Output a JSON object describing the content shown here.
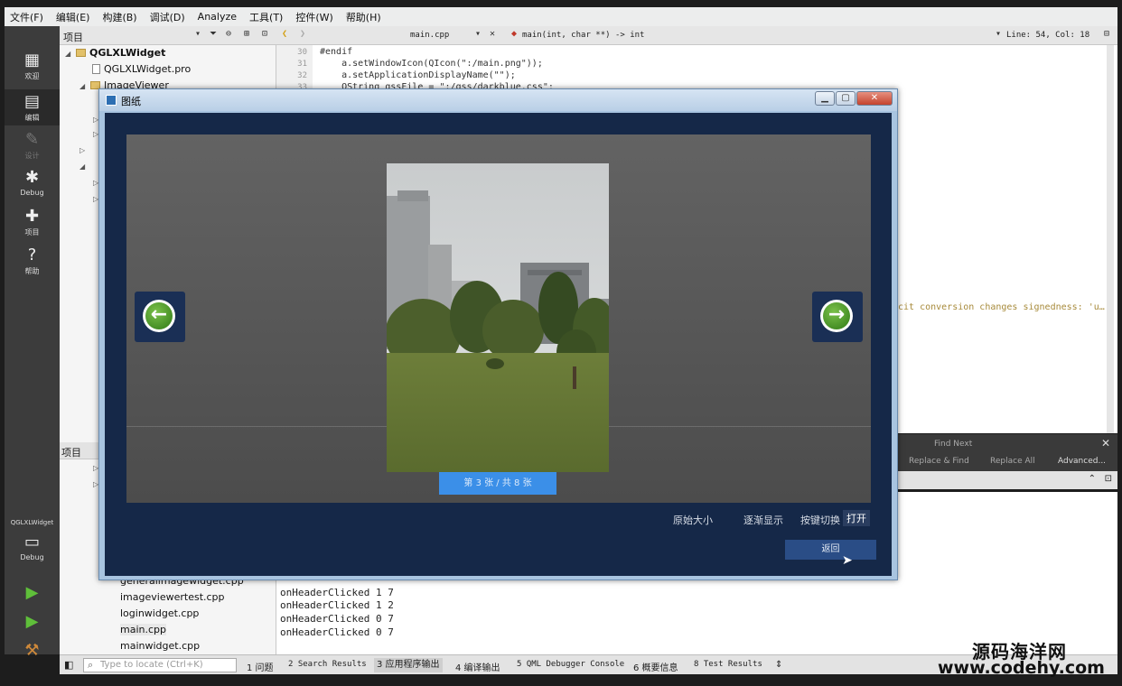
{
  "menu": [
    "文件(F)",
    "编辑(E)",
    "构建(B)",
    "调试(D)",
    "Analyze",
    "工具(T)",
    "控件(W)",
    "帮助(H)"
  ],
  "modes": [
    {
      "icon": "grid-icon",
      "label": "欢迎"
    },
    {
      "icon": "edit-icon",
      "label": "编辑"
    },
    {
      "icon": "design-icon",
      "label": "设计"
    },
    {
      "icon": "bug-icon",
      "label": "Debug"
    },
    {
      "icon": "wrench-icon",
      "label": "项目"
    },
    {
      "icon": "help-icon",
      "label": "帮助"
    }
  ],
  "kit": {
    "project": "QGLXLWidget",
    "mode": "Debug"
  },
  "toolbar": {
    "panel_title": "项目",
    "file_tab": "main.cpp",
    "function_selector": "main(int, char **) -> int",
    "line_col": "Line: 54, Col: 18"
  },
  "tree": {
    "root": "QGLXLWidget",
    "pro_file": "QGLXLWidget.pro",
    "subproject": "ImageViewer"
  },
  "tree2": {
    "header": "项目",
    "files": [
      "generalimagewidget.cpp",
      "imageviewertest.cpp",
      "loginwidget.cpp",
      "main.cpp",
      "mainwidget.cpp"
    ]
  },
  "editor": {
    "line_numbers": [
      "30",
      "31",
      "32",
      "33"
    ],
    "lines": [
      "#endif",
      "    a.setWindowIcon(QIcon(\":/main.png\"));",
      "    a.setApplicationDisplayName(\"\");",
      "    QString qssFile = \":/qss/darkblue.css\";"
    ],
    "warning": "cit conversion changes signedness: 'u…'"
  },
  "search": {
    "find_next": "Find Next",
    "replace_find": "Replace & Find",
    "replace_all": "Replace All",
    "advanced": "Advanced..."
  },
  "output": {
    "lines": [
      "onHeaderClicked 1 7",
      "onHeaderClicked 1 2",
      "onHeaderClicked 0 7",
      "onHeaderClicked 0 7"
    ]
  },
  "status": {
    "locate_placeholder": "Type to locate (Ctrl+K)",
    "panes": [
      "1 问题",
      "2 Search Results",
      "3 应用程序输出",
      "4 编译输出",
      "5 QML Debugger Console",
      "6 概要信息",
      "8 Test Results"
    ]
  },
  "dialog": {
    "title": "图纸",
    "page_indicator": "第 3 张 / 共 8 张",
    "options": {
      "original_size": "原始大小",
      "fade_in": "逐渐显示",
      "key_switch": "按键切换",
      "open": "打开"
    },
    "return_label": "返回"
  },
  "watermark": {
    "line1": "源码海洋网",
    "line2": "www.codehy.com"
  },
  "colors": {
    "dialog_bg": "#152848",
    "accent_blue": "#3b8fe8",
    "nav_green": "#2f7a15"
  }
}
